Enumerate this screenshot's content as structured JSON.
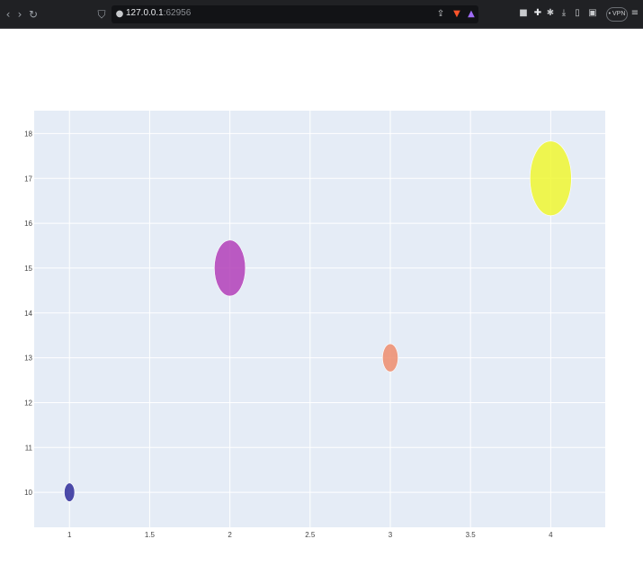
{
  "browser": {
    "url_host": "127.0.0.1",
    "url_port": ":62956",
    "vpn_label": "• VPN",
    "icons": [
      "back-icon",
      "forward-icon",
      "reload-icon",
      "bookmark-icon",
      "site-info-icon",
      "share-icon",
      "brave-shield-icon",
      "brave-rewards-icon",
      "extension-icon",
      "puzzle-icon",
      "download-icon",
      "sidebar-icon",
      "wallet-icon",
      "menu-icon"
    ]
  },
  "colors": {
    "plot_bg": "#e5ecf6",
    "grid": "#ffffff"
  },
  "chart_data": {
    "type": "scatter",
    "x": [
      1,
      2,
      3,
      4
    ],
    "y": [
      10,
      15,
      13,
      17
    ],
    "size": [
      10,
      30,
      15,
      40
    ],
    "colors": [
      "#2f2d9a",
      "#b33fb8",
      "#ef8d6d",
      "#f0f731"
    ],
    "xticks": [
      1,
      1.5,
      2,
      2.5,
      3,
      3.5,
      4
    ],
    "xtick_labels": [
      "1",
      "1.5",
      "2",
      "2.5",
      "3",
      "3.5",
      "4"
    ],
    "yticks": [
      10,
      11,
      12,
      13,
      14,
      15,
      16,
      17,
      18
    ],
    "ytick_labels": [
      "10",
      "11",
      "12",
      "13",
      "14",
      "15",
      "16",
      "17",
      "18"
    ],
    "xlim": [
      0.78,
      4.34
    ],
    "ylim": [
      9.22,
      18.51
    ],
    "grid": true,
    "legend": "none"
  }
}
